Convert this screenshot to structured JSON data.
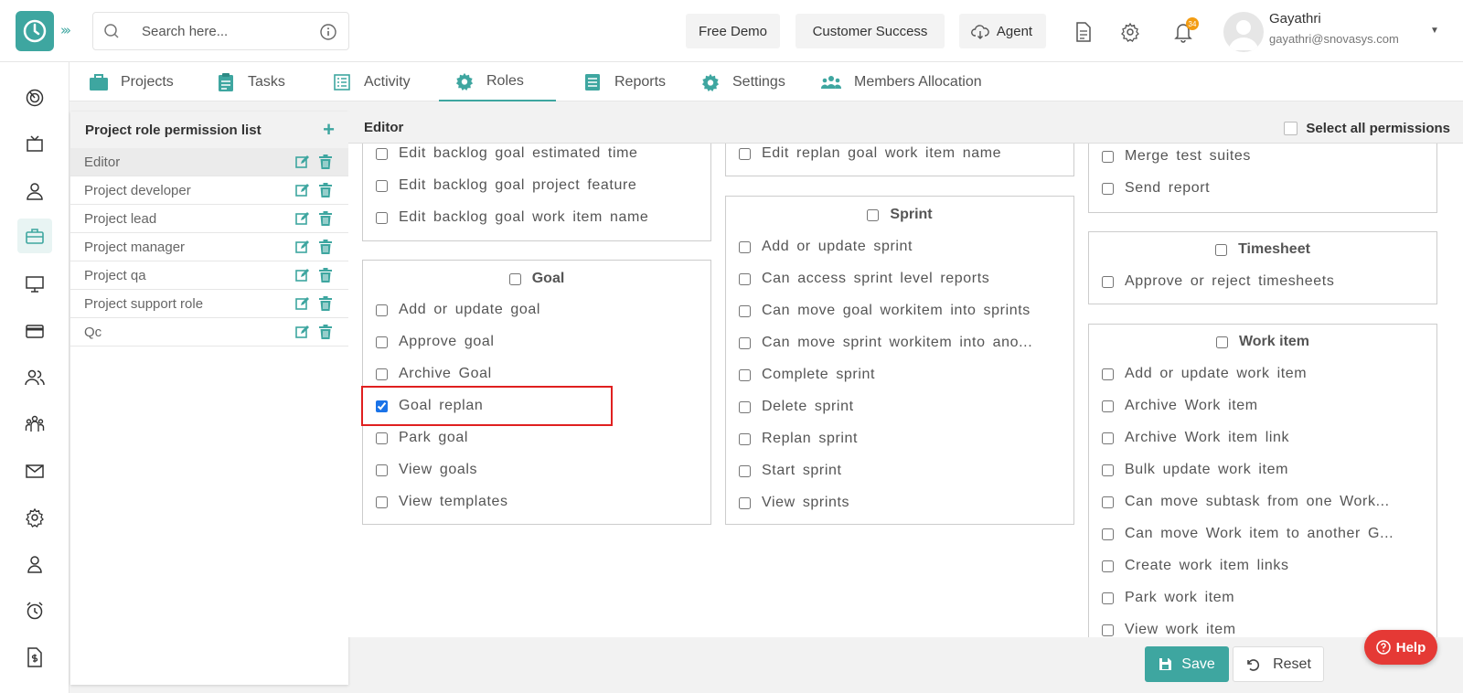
{
  "header": {
    "search_placeholder": "Search here...",
    "buttons": [
      "Free Demo",
      "Customer Success",
      "Agent"
    ],
    "notification_count": "34",
    "user": {
      "name": "Gayathri",
      "email": "gayathri@snovasys.com"
    }
  },
  "tabs": [
    "Projects",
    "Tasks",
    "Activity",
    "Roles",
    "Reports",
    "Settings",
    "Members Allocation"
  ],
  "active_tab": "Roles",
  "role_panel": {
    "title": "Project role permission list",
    "roles": [
      "Editor",
      "Project developer",
      "Project lead",
      "Project manager",
      "Project qa",
      "Project support role",
      "Qc"
    ],
    "selected": "Editor"
  },
  "editor": {
    "title": "Editor",
    "select_all_label": "Select all permissions",
    "col1_top": [
      "Edit backlog goal estimated time",
      "Edit backlog goal project feature",
      "Edit backlog goal work item name"
    ],
    "goal": {
      "title": "Goal",
      "items": [
        "Add or update goal",
        "Approve goal",
        "Archive Goal",
        "Goal replan",
        "Park goal",
        "View goals",
        "View templates"
      ],
      "checked": [
        false,
        false,
        false,
        true,
        false,
        false,
        false
      ]
    },
    "col2_top": [
      "Edit replan goal work item name"
    ],
    "sprint": {
      "title": "Sprint",
      "items": [
        "Add or update sprint",
        "Can access sprint level reports",
        "Can move goal workitem into sprints",
        "Can move sprint workitem into ano...",
        "Complete sprint",
        "Delete sprint",
        "Replan sprint",
        "Start sprint",
        "View sprints"
      ]
    },
    "col3_top": [
      "Merge test suites",
      "Send report"
    ],
    "timesheet": {
      "title": "Timesheet",
      "items": [
        "Approve or reject timesheets"
      ]
    },
    "work_item": {
      "title": "Work item",
      "items": [
        "Add or update work item",
        "Archive Work item",
        "Archive Work item link",
        "Bulk update work item",
        "Can move subtask from one Work...",
        "Can move Work item to another G...",
        "Create work item links",
        "Park work item",
        "View work item"
      ]
    }
  },
  "actions": {
    "save": "Save",
    "reset": "Reset",
    "help": "Help"
  },
  "colors": {
    "accent": "#3ea6a0",
    "danger": "#e53935",
    "highlight": "#e02020"
  }
}
